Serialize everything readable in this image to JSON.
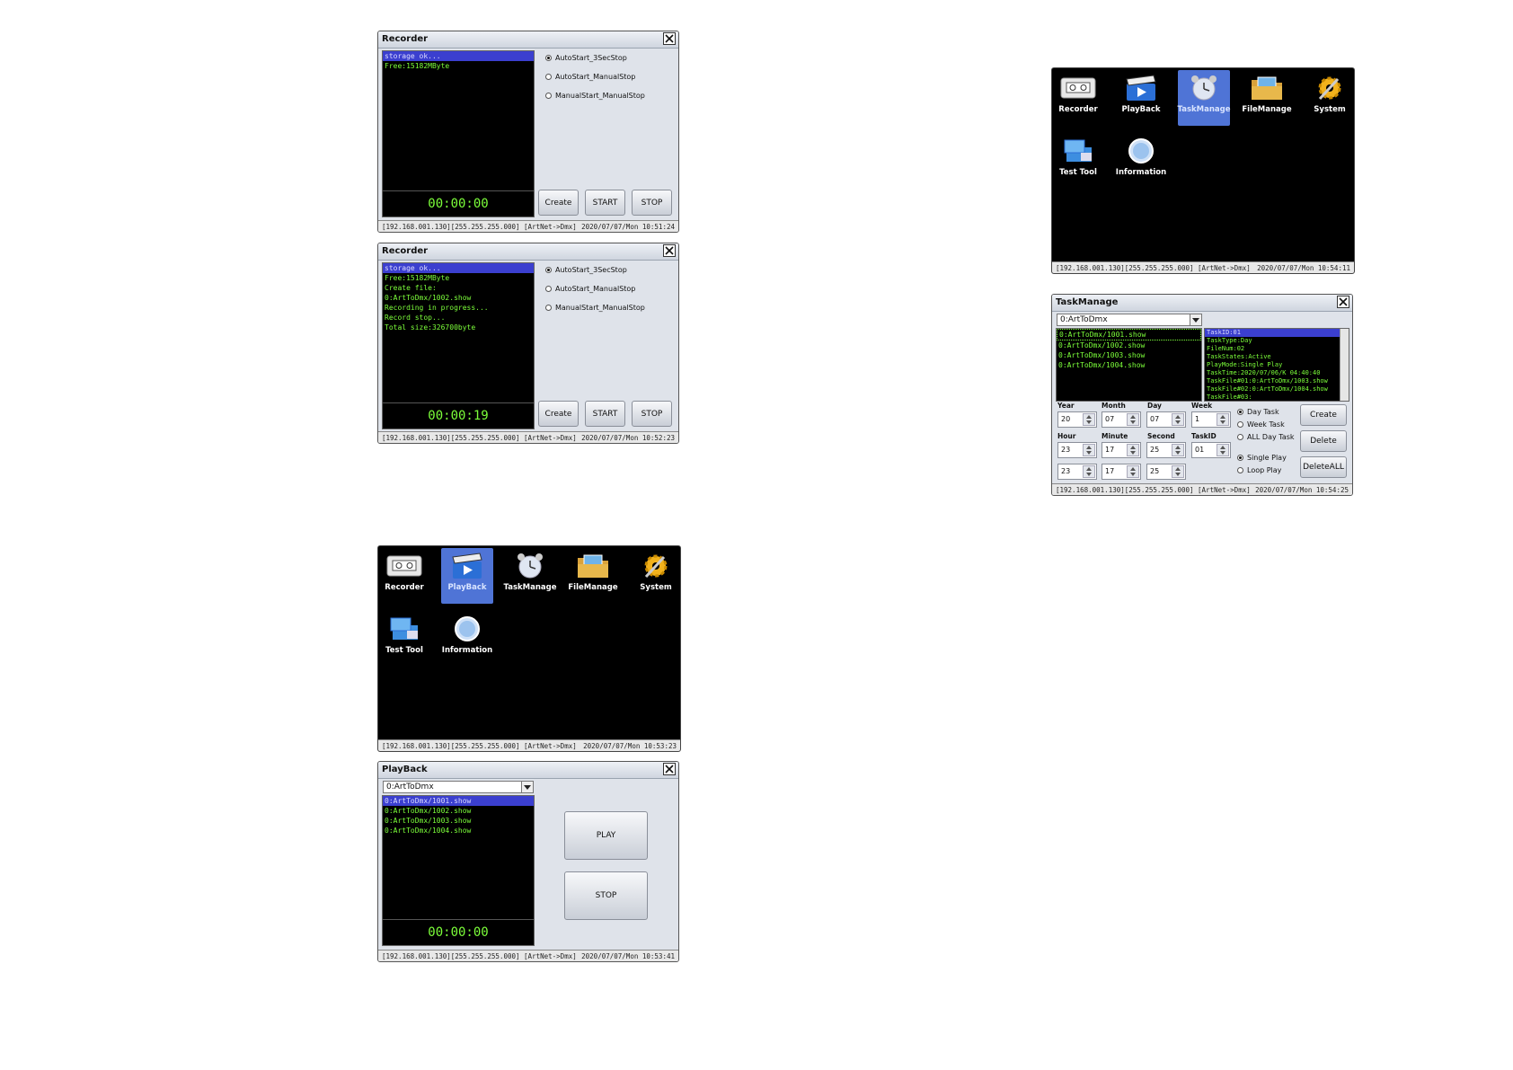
{
  "recorder1": {
    "title": "Recorder",
    "log": [
      "storage ok...",
      "Free:15182MByte"
    ],
    "timer": "00:00:00",
    "options": [
      "AutoStart_3SecStop",
      "AutoStart_ManualStop",
      "ManualStart_ManualStop"
    ],
    "selected_option": "AutoStart_3SecStop",
    "buttons": {
      "create": "Create",
      "start": "START",
      "stop": "STOP"
    },
    "status_left": "[192.168.001.130][255.255.255.000] [ArtNet->Dmx]",
    "status_right": "2020/07/07/Mon 10:51:24"
  },
  "recorder2": {
    "title": "Recorder",
    "log": [
      "storage ok...",
      "Free:15182MByte",
      "Create file:",
      "0:ArtToDmx/1002.show",
      "Recording in progress...",
      "Record stop...",
      "Total size:326700byte"
    ],
    "timer": "00:00:19",
    "options": [
      "AutoStart_3SecStop",
      "AutoStart_ManualStop",
      "ManualStart_ManualStop"
    ],
    "selected_option": "AutoStart_3SecStop",
    "buttons": {
      "create": "Create",
      "start": "START",
      "stop": "STOP"
    },
    "status_left": "[192.168.001.130][255.255.255.000] [ArtNet->Dmx]",
    "status_right": "2020/07/07/Mon 10:52:23"
  },
  "desktop_playback": {
    "apps": [
      "Recorder",
      "PlayBack",
      "TaskManage",
      "FileManage",
      "System",
      "Test Tool",
      "Information"
    ],
    "selected": "PlayBack",
    "status_left": "[192.168.001.130][255.255.255.000] [ArtNet->Dmx]",
    "status_right": "2020/07/07/Mon 10:53:23"
  },
  "playback": {
    "title": "PlayBack",
    "folder": "0:ArtToDmx",
    "files": [
      "0:ArtToDmx/1001.show",
      "0:ArtToDmx/1002.show",
      "0:ArtToDmx/1003.show",
      "0:ArtToDmx/1004.show"
    ],
    "timer": "00:00:00",
    "buttons": {
      "play": "PLAY",
      "stop": "STOP"
    },
    "status_left": "[192.168.001.130][255.255.255.000] [ArtNet->Dmx]",
    "status_right": "2020/07/07/Mon 10:53:41"
  },
  "desktop_taskmanage": {
    "apps": [
      "Recorder",
      "PlayBack",
      "TaskManage",
      "FileManage",
      "System",
      "Test Tool",
      "Information"
    ],
    "selected": "TaskManage",
    "status_left": "[192.168.001.130][255.255.255.000] [ArtNet->Dmx]",
    "status_right": "2020/07/07/Mon 10:54:11"
  },
  "taskmanage": {
    "title": "TaskManage",
    "folder": "0:ArtToDmx",
    "files": [
      "0:ArtToDmx/1001.show",
      "0:ArtToDmx/1002.show",
      "0:ArtToDmx/1003.show",
      "0:ArtToDmx/1004.show"
    ],
    "task_info": [
      "TaskID:01",
      "TaskType:Day",
      "FileNum:02",
      "TaskStates:Active",
      "PlayMode:Single Play",
      "TaskTime:2020/07/06/K 04:40:40",
      "TaskFile#01:0:ArtToDmx/1003.show",
      "TaskFile#02:0:ArtToDmx/1004.show",
      "TaskFile#03:"
    ],
    "labels": {
      "year": "Year",
      "month": "Month",
      "day": "Day",
      "week": "Week",
      "hour": "Hour",
      "minute": "Minute",
      "second": "Second",
      "taskid": "TaskID"
    },
    "values": {
      "year": "20",
      "month": "07",
      "day": "07",
      "week": "1",
      "hour": "23",
      "minute": "17",
      "second": "25",
      "taskid": "01",
      "hour2": "23",
      "minute2": "17",
      "second2": "25"
    },
    "task_types": [
      "Day Task",
      "Week Task",
      "ALL Day Task"
    ],
    "selected_task_type": "Day Task",
    "play_modes": [
      "Single Play",
      "Loop Play"
    ],
    "selected_play_mode": "Single Play",
    "buttons": {
      "create": "Create",
      "delete": "Delete",
      "delete_all": "DeleteALL"
    },
    "status_left": "[192.168.001.130][255.255.255.000] [ArtNet->Dmx]",
    "status_right": "2020/07/07/Mon 10:54:25"
  }
}
